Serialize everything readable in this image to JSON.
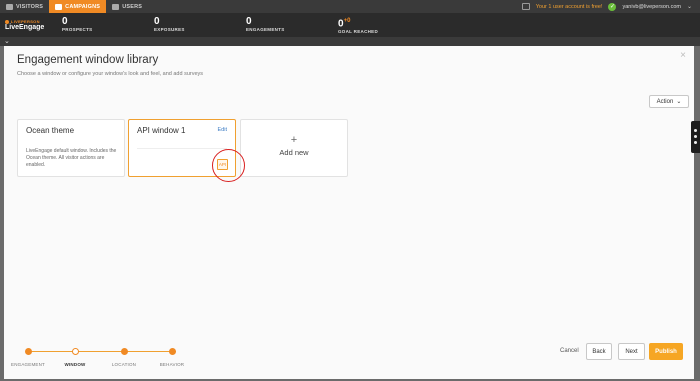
{
  "topnav": {
    "tabs": [
      {
        "label": "VISITORS",
        "icon": "visitors-icon"
      },
      {
        "label": "CAMPAIGNS",
        "icon": "campaigns-icon"
      },
      {
        "label": "USERS",
        "icon": "users-icon"
      }
    ],
    "free_message": "Your 1 user account is free!",
    "user_email": "yanivb@liveperson.com"
  },
  "brand": {
    "top": "LIVEPERSON",
    "main": "LiveEngage"
  },
  "stats": [
    {
      "value": "0",
      "label": "PROSPECTS",
      "delta": ""
    },
    {
      "value": "0",
      "label": "EXPOSURES",
      "delta": ""
    },
    {
      "value": "0",
      "label": "ENGAGEMENTS",
      "delta": ""
    },
    {
      "value": "0",
      "label": "GOAL REACHED",
      "delta": "+0"
    }
  ],
  "panel": {
    "title": "Engagement window library",
    "subtitle": "Choose a window or configure your window's look and feel, and add surveys",
    "action_label": "Action"
  },
  "cards": {
    "ocean": {
      "title": "Ocean theme",
      "description": "LiveEngage default window. Includes the Ocean theme. All visitor actions are enabled."
    },
    "api": {
      "title": "API window 1",
      "edit": "Edit",
      "badge": "API"
    },
    "add": {
      "plus": "+",
      "label": "Add new"
    }
  },
  "wizard": {
    "steps": [
      "ENGAGEMENT",
      "WINDOW",
      "LOCATION",
      "BEHAVIOR"
    ],
    "current": "WINDOW"
  },
  "footer": {
    "cancel": "Cancel",
    "back": "Back",
    "next": "Next",
    "publish": "Publish"
  },
  "colors": {
    "accent": "#f08a24",
    "publish": "#f6a623",
    "link": "#3b7bc4",
    "highlight_circle": "#d92020"
  }
}
